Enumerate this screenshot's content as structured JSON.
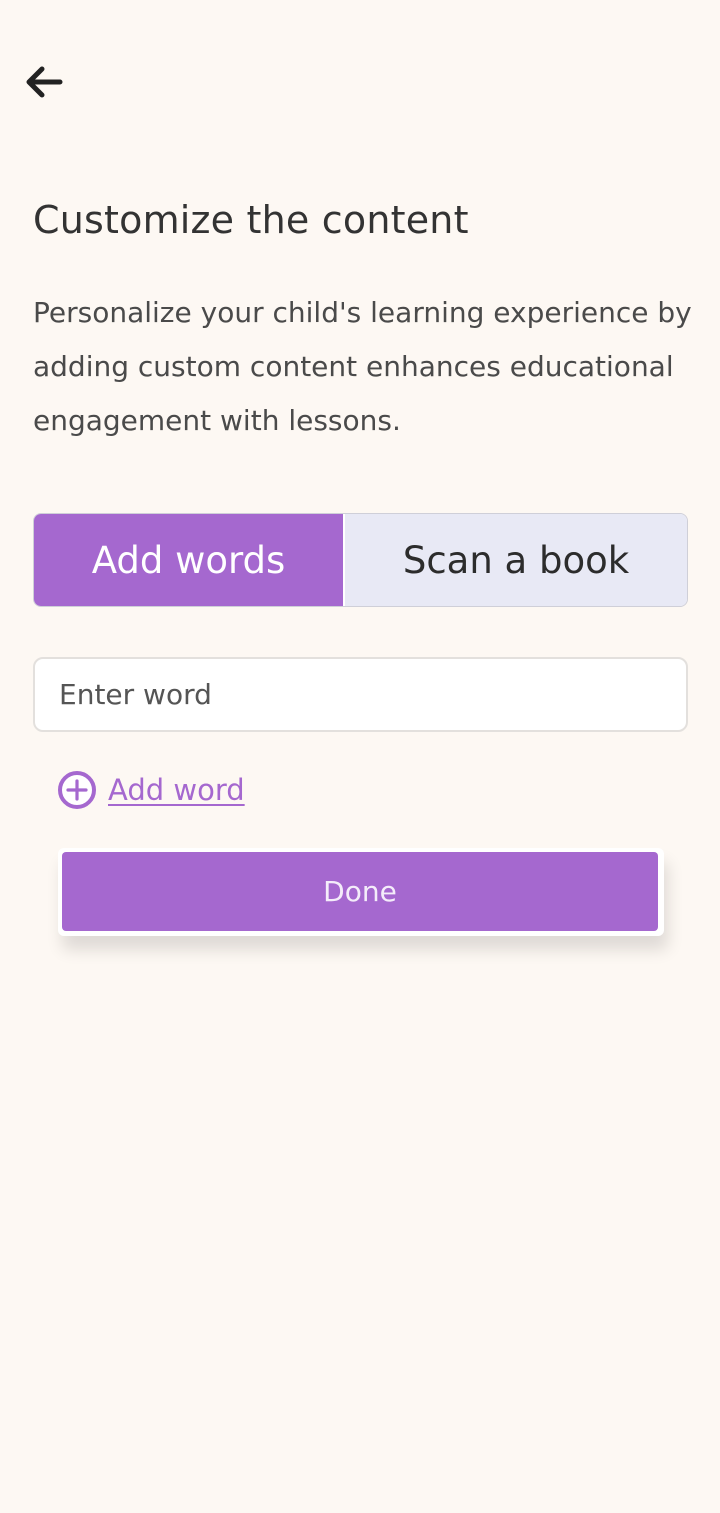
{
  "header": {
    "back_icon": "arrow-left-icon"
  },
  "content": {
    "title": "Customize the content",
    "description": "Personalize your child's learning experience by adding custom content enhances educational engagement with lessons."
  },
  "tabs": [
    {
      "label": "Add words",
      "active": true
    },
    {
      "label": "Scan a book",
      "active": false
    }
  ],
  "word_input": {
    "value": "",
    "placeholder": "Enter word"
  },
  "add_word": {
    "icon": "plus-circle-icon",
    "label": " Add word"
  },
  "done_button": {
    "label": "Done"
  },
  "colors": {
    "accent": "#a568cf",
    "background": "#fdf8f3",
    "inactive_tab": "#e8e9f5"
  }
}
